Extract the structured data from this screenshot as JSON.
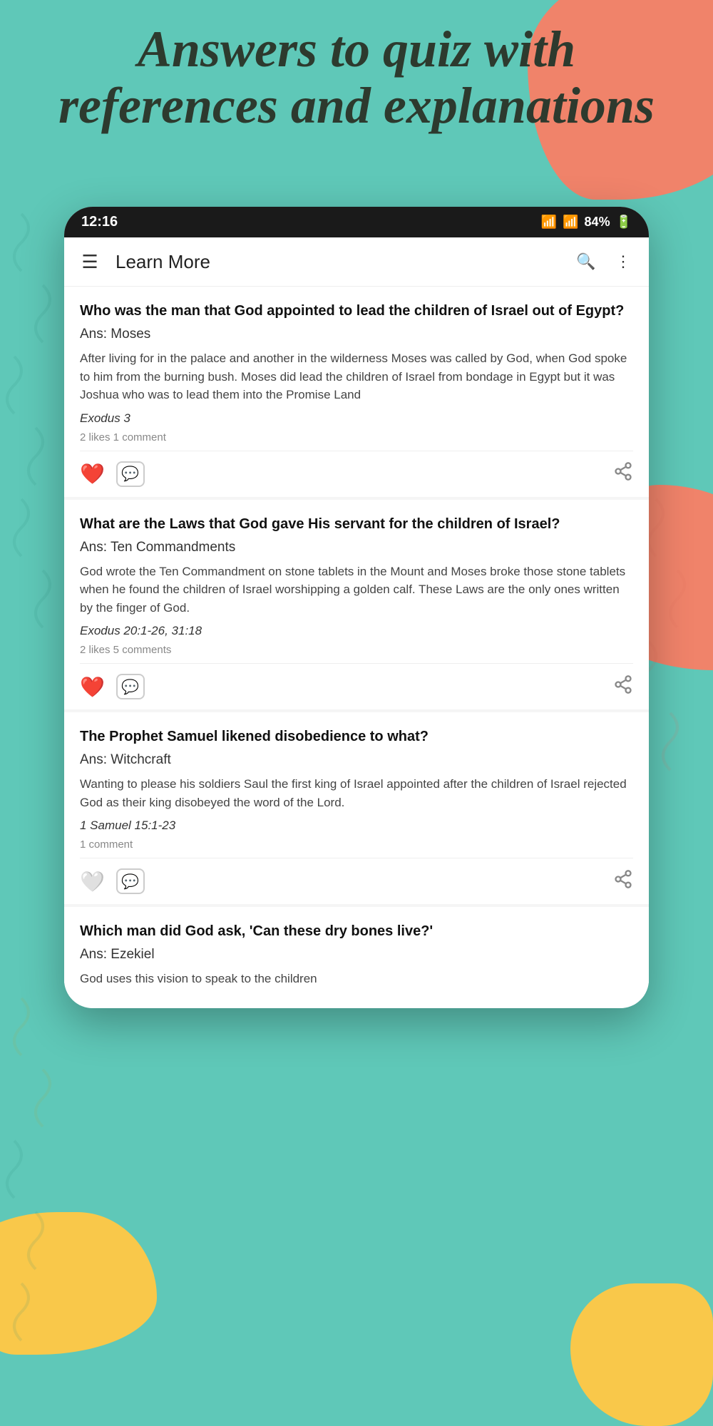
{
  "background": {
    "color": "#5fc8b8"
  },
  "header": {
    "line1": "Answers to quiz with",
    "line2": "references and explanations"
  },
  "statusBar": {
    "time": "12:16",
    "battery": "84%"
  },
  "appBar": {
    "title": "Learn More",
    "menuIcon": "☰",
    "searchIcon": "🔍",
    "moreIcon": "⋮"
  },
  "cards": [
    {
      "question": "Who was the man that God appointed to lead the children of Israel out of Egypt?",
      "answer": "Ans: Moses",
      "explanation": "After living for in the palace and another in the wilderness Moses was called by God, when God spoke to him from the burning bush. Moses did lead the children of Israel from bondage in Egypt but it was Joshua who was to lead them into the Promise Land",
      "reference": "Exodus 3",
      "meta": "2 likes  1 comment",
      "liked": true
    },
    {
      "question": "What are the Laws that God gave His servant for the children of Israel?",
      "answer": "Ans: Ten Commandments",
      "explanation": "God wrote the Ten Commandment on stone tablets in the Mount and Moses broke those stone tablets when he found the children of Israel worshipping a golden calf. These Laws are the only ones written by the finger of God.",
      "reference": "Exodus 20:1-26, 31:18",
      "meta": "2 likes  5 comments",
      "liked": true
    },
    {
      "question": "The Prophet Samuel likened disobedience to what?",
      "answer": "Ans: Witchcraft",
      "explanation": "Wanting to please his soldiers Saul the first king of Israel appointed after the children of Israel rejected God as their king disobeyed the word of the Lord.",
      "reference": "1 Samuel 15:1-23",
      "meta": "1 comment",
      "liked": false
    },
    {
      "question": "Which man did God ask, 'Can these dry bones live?'",
      "answer": "Ans: Ezekiel",
      "explanation": "God uses this vision to speak to the children",
      "reference": "",
      "meta": "",
      "liked": false
    }
  ]
}
